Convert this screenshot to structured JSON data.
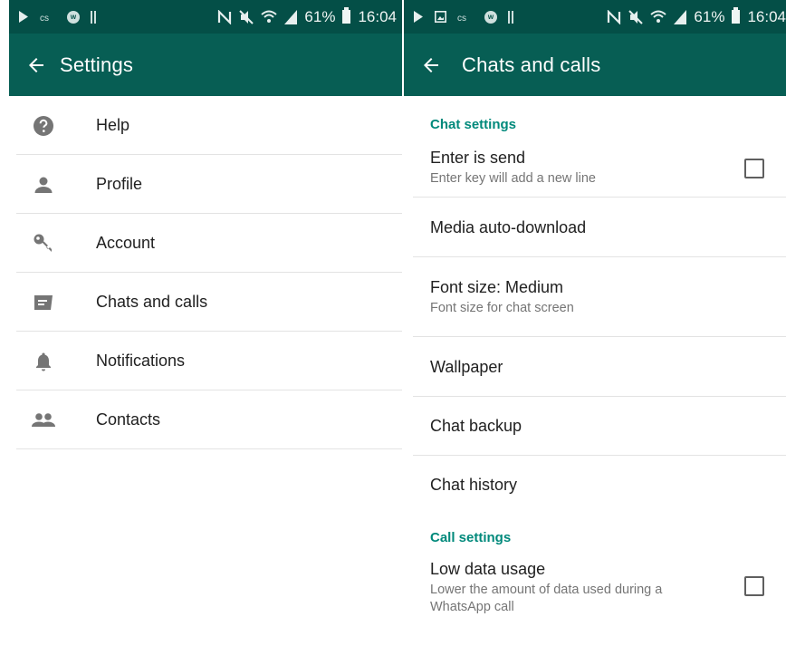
{
  "status_bar": {
    "battery_percent": "61%",
    "time": "16:04",
    "left_icons": [
      "play-icon",
      "cs-icon",
      "w-icon",
      "bars-icon"
    ],
    "right_icons": [
      "nfc-icon",
      "mute-icon",
      "wifi-icon",
      "signal-icon",
      "battery-icon"
    ],
    "right_screen_extra_icon": "image-icon"
  },
  "settings_screen": {
    "title": "Settings",
    "items": [
      {
        "label": "Help",
        "icon": "help-icon"
      },
      {
        "label": "Profile",
        "icon": "person-icon"
      },
      {
        "label": "Account",
        "icon": "key-icon"
      },
      {
        "label": "Chats and calls",
        "icon": "chat-icon"
      },
      {
        "label": "Notifications",
        "icon": "bell-icon"
      },
      {
        "label": "Contacts",
        "icon": "people-icon"
      }
    ]
  },
  "chats_screen": {
    "title": "Chats and calls",
    "chat_settings_header": "Chat settings",
    "enter_is_send": {
      "title": "Enter is send",
      "summary": "Enter key will add a new line",
      "checked": false
    },
    "media_auto_download": {
      "title": "Media auto-download"
    },
    "font_size": {
      "title": "Font size: Medium",
      "summary": "Font size for chat screen"
    },
    "wallpaper": {
      "title": "Wallpaper"
    },
    "chat_backup": {
      "title": "Chat backup"
    },
    "chat_history": {
      "title": "Chat history"
    },
    "call_settings_header": "Call settings",
    "low_data_usage": {
      "title": "Low data usage",
      "summary_line1": "Lower the amount of data used during a",
      "summary_line2": "WhatsApp call",
      "checked": false
    }
  },
  "colors": {
    "status_bar": "#044f47",
    "toolbar": "#075e54",
    "accent": "#00897b",
    "icon_gray": "#757575"
  }
}
